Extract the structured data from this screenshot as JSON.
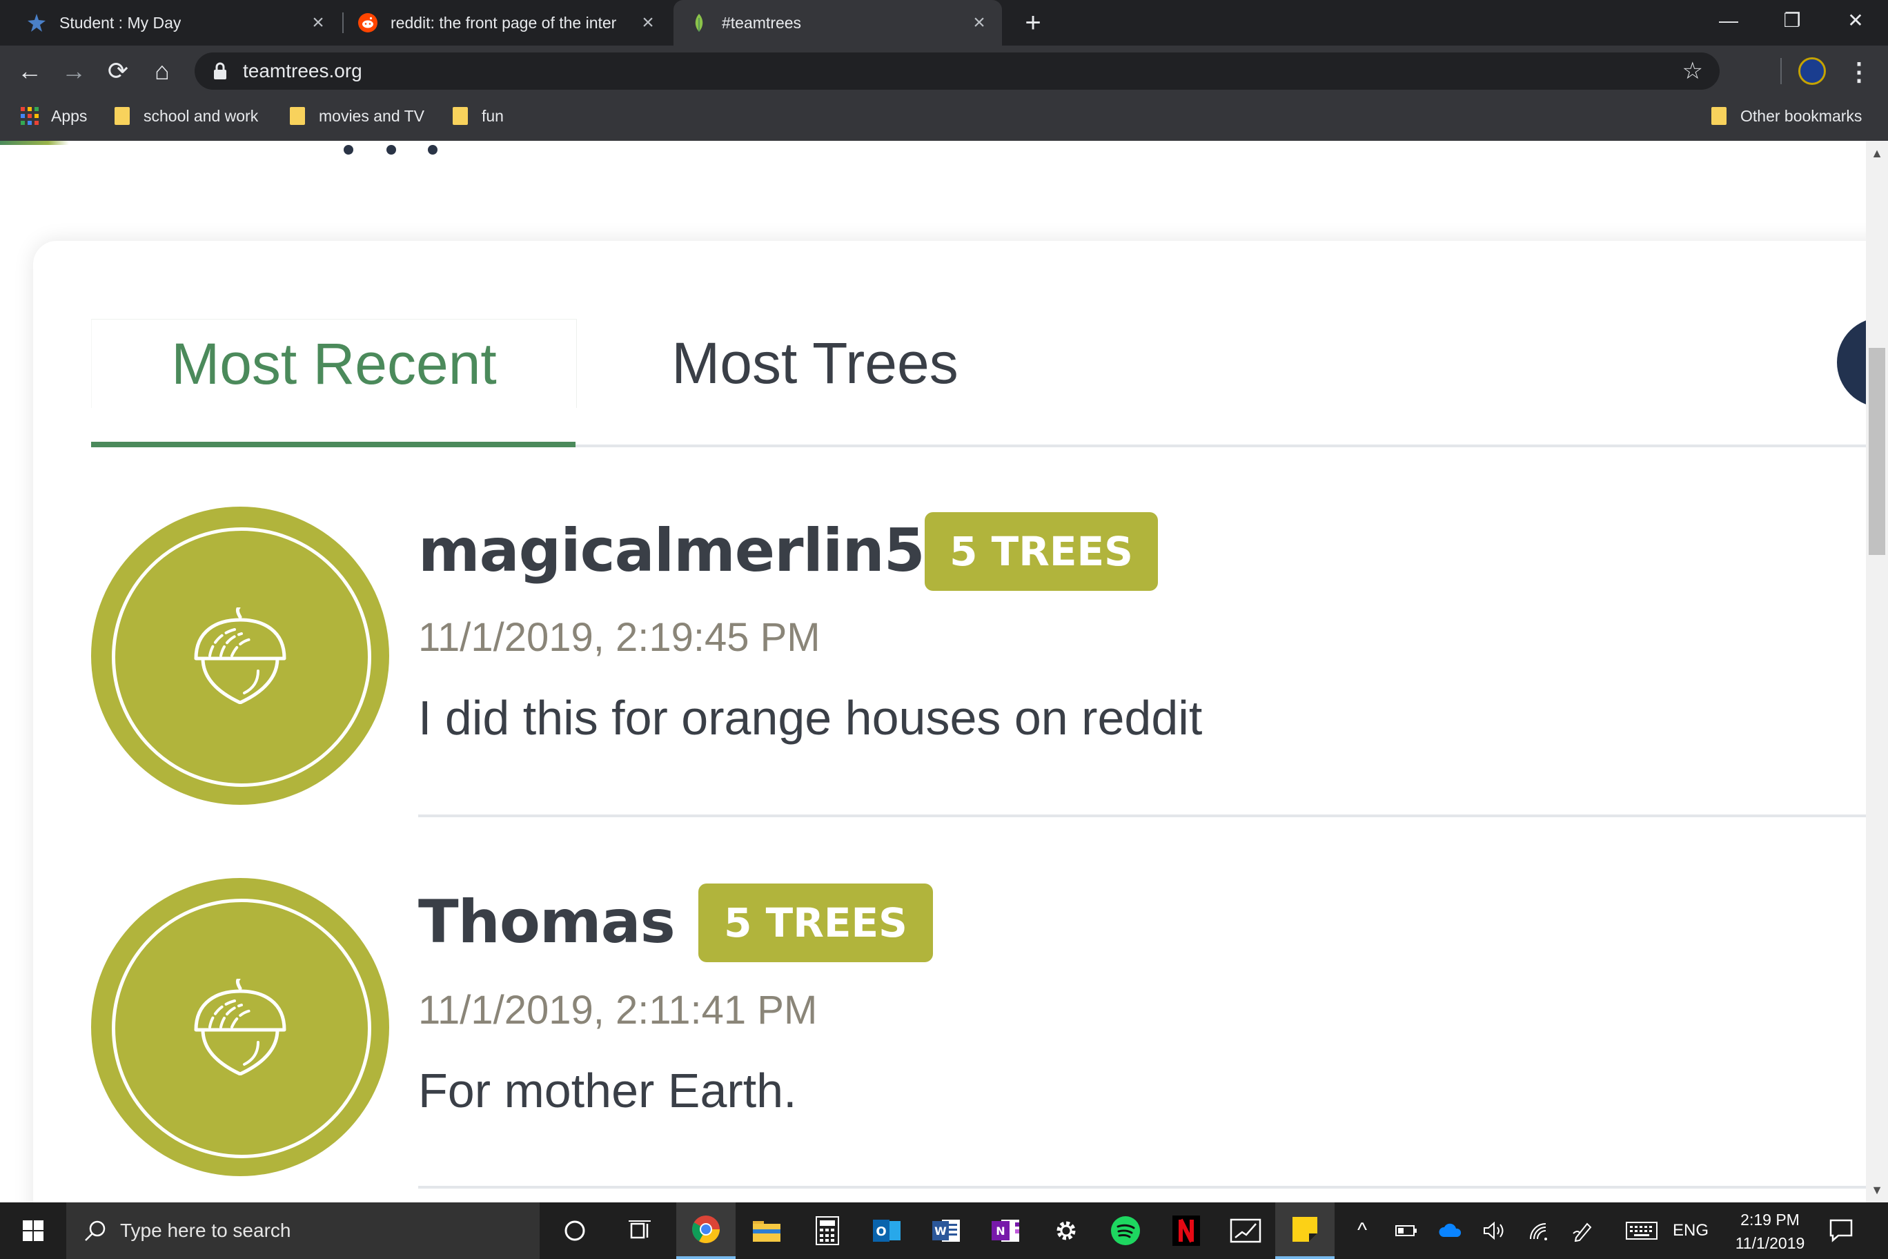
{
  "browser": {
    "tabs": [
      {
        "title": "Student : My Day",
        "icon": "my-day-icon",
        "active": false
      },
      {
        "title": "reddit: the front page of the inter",
        "icon": "reddit-icon",
        "active": false
      },
      {
        "title": "#teamtrees",
        "icon": "teamtrees-leaf-icon",
        "active": true
      }
    ],
    "new_tab_label": "+",
    "url": "teamtrees.org",
    "bookmarks": {
      "apps": "Apps",
      "items": [
        "school and work",
        "movies and TV",
        "fun"
      ],
      "other": "Other bookmarks"
    }
  },
  "page": {
    "tabs": [
      {
        "label": "Most Recent",
        "active": true
      },
      {
        "label": "Most Trees",
        "active": false
      }
    ],
    "donations": [
      {
        "name": "magicalmerlin5",
        "trees": "5 TREES",
        "timestamp": "11/1/2019, 2:19:45 PM",
        "message": "I did this for orange houses on reddit"
      },
      {
        "name": "Thomas",
        "trees": "5 TREES",
        "timestamp": "11/1/2019, 2:11:41 PM",
        "message": "For mother Earth."
      }
    ],
    "colors": {
      "accent_green": "#4b8a5b",
      "badge_olive": "#b1b43c",
      "text_dark": "#3a3f47"
    }
  },
  "taskbar": {
    "search_placeholder": "Type here to search",
    "apps": [
      "cortana-icon",
      "task-view-icon",
      "chrome-icon",
      "file-explorer-icon",
      "calculator-icon",
      "outlook-icon",
      "word-icon",
      "onenote-icon",
      "settings-icon",
      "spotify-icon",
      "netflix-icon",
      "whiteboard-icon",
      "sticky-notes-icon"
    ],
    "language": "ENG",
    "time": "2:19 PM",
    "date": "11/1/2019"
  }
}
